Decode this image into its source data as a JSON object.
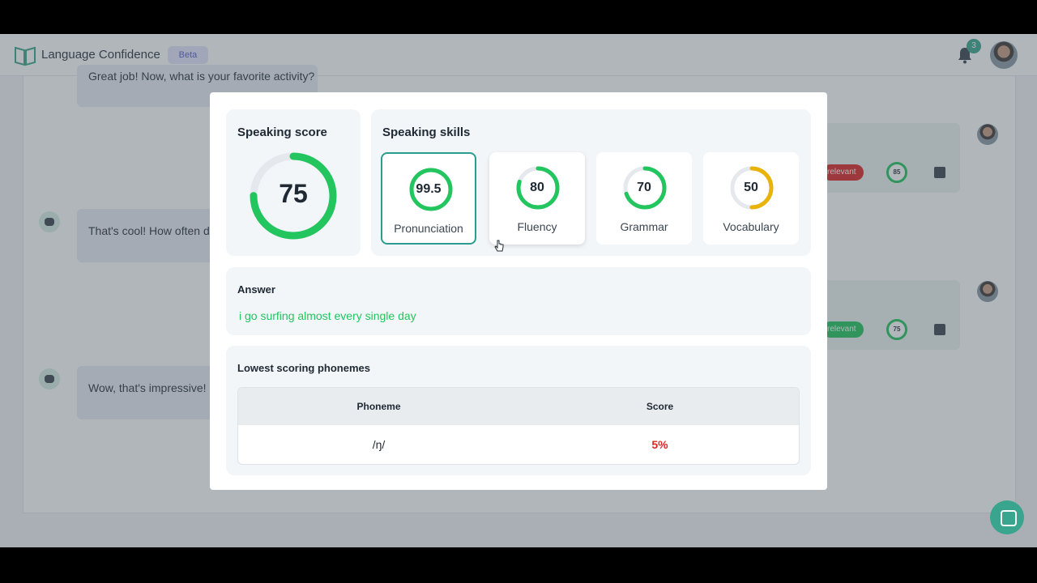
{
  "header": {
    "brand": "Language Confidence",
    "beta": "Beta",
    "notification_count": "3"
  },
  "background": {
    "bubble_top": "Great job! Now, what is your favorite activity?",
    "bubble_mid": "That's cool! How often do",
    "bubble_low": "Wow, that's impressive! If",
    "pill_1": "relevant",
    "pill_2": "relevant",
    "ring_1": "85",
    "ring_2": "75"
  },
  "modal": {
    "speaking_score": {
      "title": "Speaking score",
      "value": "75",
      "progress": 0.75
    },
    "skills_title": "Speaking skills",
    "skills": [
      {
        "label": "Pronunciation",
        "value": "99.5",
        "progress": 0.995,
        "color": "#22c55e"
      },
      {
        "label": "Fluency",
        "value": "80",
        "progress": 0.8,
        "color": "#22c55e"
      },
      {
        "label": "Grammar",
        "value": "70",
        "progress": 0.7,
        "color": "#22c55e"
      },
      {
        "label": "Vocabulary",
        "value": "50",
        "progress": 0.5,
        "color": "#eab308"
      }
    ],
    "answer": {
      "title": "Answer",
      "text": "i go surfing almost every single day"
    },
    "phonemes": {
      "title": "Lowest scoring phonemes",
      "headers": [
        "Phoneme",
        "Score"
      ],
      "rows": [
        {
          "phoneme": "/ŋ/",
          "score": "5%"
        }
      ]
    }
  },
  "colors": {
    "accent": "#3aa58e",
    "good": "#22c55e",
    "warn": "#eab308",
    "bad": "#dc2626"
  }
}
